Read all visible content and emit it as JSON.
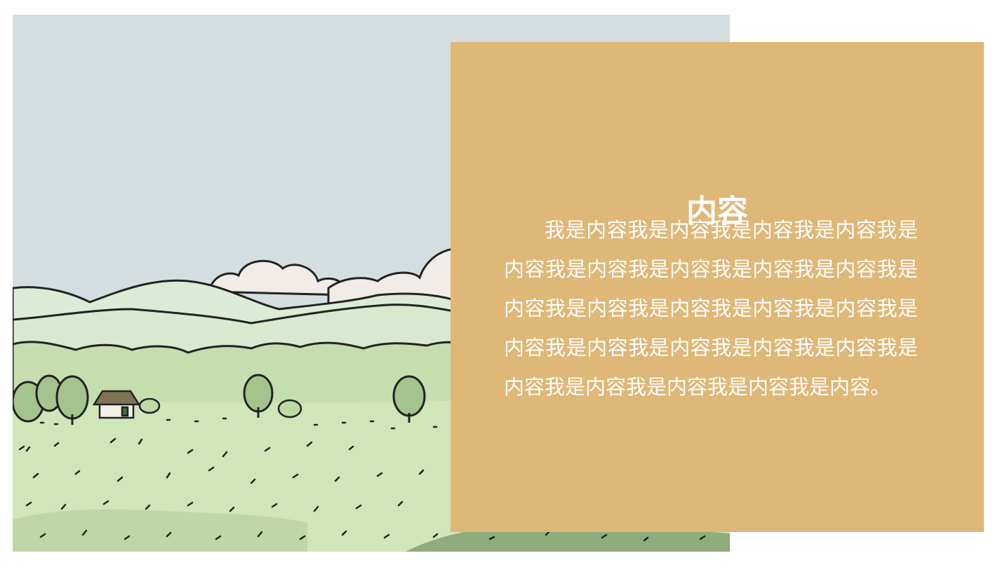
{
  "slide": {
    "title": "内容",
    "body": "我是内容我是内容我是内容我是内容我是内容我是内容我是内容我是内容我是内容我是内容我是内容我是内容我是内容我是内容我是内容我是内容我是内容我是内容我是内容我是内容我是内容我是内容我是内容我是内容。"
  },
  "colors": {
    "panel": "#dfb777",
    "text": "#ffffff",
    "sky": "#d4dee0",
    "hills": "#c9e0b8",
    "meadow": "#cfe3b9"
  },
  "image": {
    "icon": "countryside-landscape-illustration"
  }
}
